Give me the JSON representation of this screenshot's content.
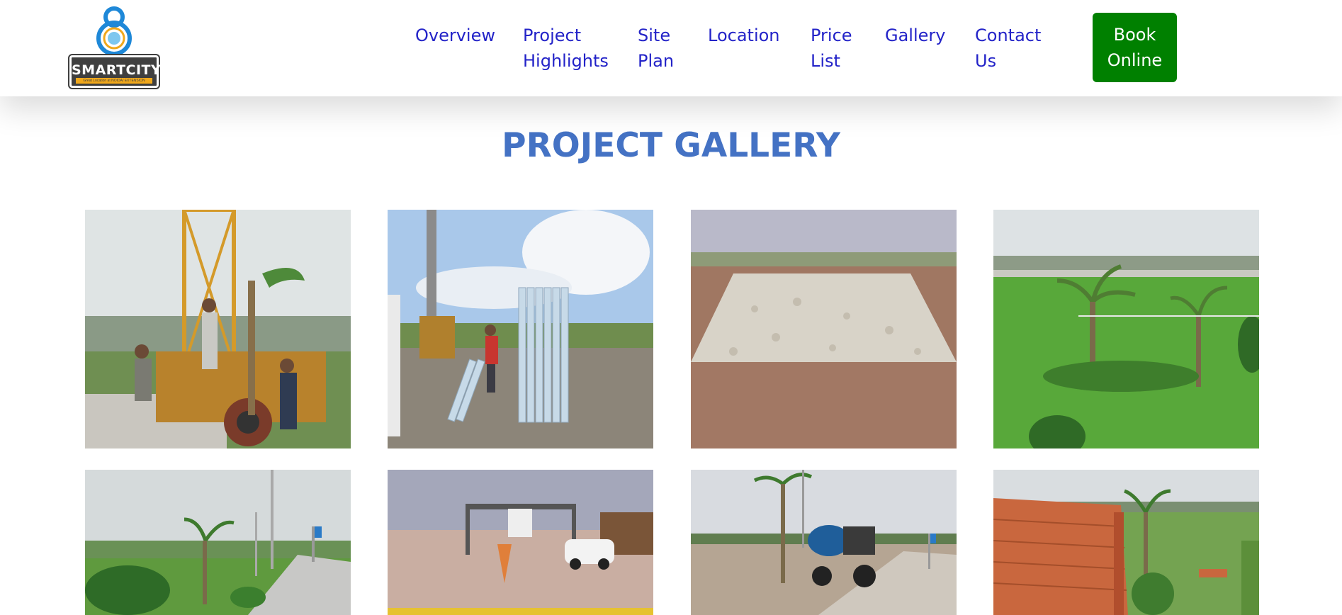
{
  "brand": {
    "logo_text": "SMARTCITY",
    "tagline": "Great Location at NOIDA/ EXTENSION"
  },
  "nav": {
    "items": [
      {
        "line1": "Overview",
        "line2": ""
      },
      {
        "line1": "Project",
        "line2": "Highlights"
      },
      {
        "line1": "Site",
        "line2": "Plan"
      },
      {
        "line1": "Location",
        "line2": ""
      },
      {
        "line1": "Price",
        "line2": "List"
      },
      {
        "line1": "Gallery",
        "line2": ""
      },
      {
        "line1": "Contact",
        "line2": "Us"
      }
    ],
    "book_line1": "Book",
    "book_line2": "Online"
  },
  "gallery": {
    "title": "PROJECT GALLERY",
    "images": [
      "borewell-drilling-rig-icon",
      "pvc-pipes-and-rig-icon",
      "gravel-road-bed-icon",
      "landscaped-green-lawn-icon",
      "tree-lined-pathway-icon",
      "entrance-gate-with-car-icon",
      "water-tanker-tractor-icon",
      "brick-stacks-and-wall-icon"
    ]
  },
  "colors": {
    "nav_link": "#2323c8",
    "book_button": "#008000",
    "title": "#4472c4"
  }
}
